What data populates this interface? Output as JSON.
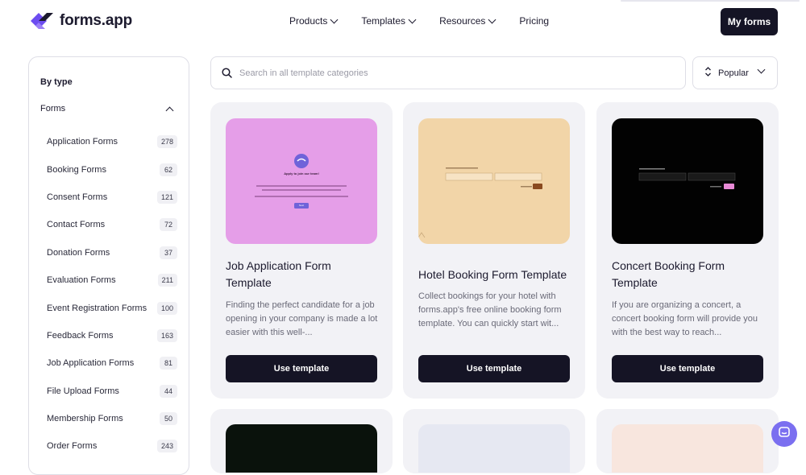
{
  "header": {
    "logo_text": "forms.app",
    "nav": [
      {
        "label": "Products",
        "dropdown": true
      },
      {
        "label": "Templates",
        "dropdown": true
      },
      {
        "label": "Resources",
        "dropdown": true
      },
      {
        "label": "Pricing",
        "dropdown": false
      }
    ],
    "my_forms_label": "My forms"
  },
  "sidebar": {
    "title": "By type",
    "group_label": "Forms",
    "items": [
      {
        "label": "Application Forms",
        "count": "278"
      },
      {
        "label": "Booking Forms",
        "count": "62"
      },
      {
        "label": "Consent Forms",
        "count": "121"
      },
      {
        "label": "Contact Forms",
        "count": "72"
      },
      {
        "label": "Donation Forms",
        "count": "37"
      },
      {
        "label": "Evaluation Forms",
        "count": "211"
      },
      {
        "label": "Event Registration Forms",
        "count": "100"
      },
      {
        "label": "Feedback Forms",
        "count": "163"
      },
      {
        "label": "Job Application Forms",
        "count": "81"
      },
      {
        "label": "File Upload Forms",
        "count": "44"
      },
      {
        "label": "Membership Forms",
        "count": "50"
      },
      {
        "label": "Order Forms",
        "count": "243"
      }
    ]
  },
  "search": {
    "placeholder": "Search in all template categories"
  },
  "sort": {
    "label": "Popular",
    "icon": "sort-arrows-icon"
  },
  "cards": [
    {
      "title": "Job Application Form Template",
      "description": "Finding the perfect candidate for a job opening in your company is made a lot easier with this well-...",
      "button": "Use template",
      "thumb_color": "#e59ee8",
      "thumb_heading": "Apply to join our team!",
      "thumb_button": "Next"
    },
    {
      "title": "Hotel Booking Form Template",
      "description": "Collect bookings for your hotel with forms.app's free online booking form template. You can quickly start wit...",
      "button": "Use template",
      "thumb_color": "#f2d5a8"
    },
    {
      "title": "Concert Booking Form Template",
      "description": "If you are organizing a concert, a concert booking form will provide you with the best way to reach...",
      "button": "Use template",
      "thumb_color": "#020202"
    }
  ],
  "colors": {
    "accent": "#151425",
    "brand": "#6c4cf0",
    "chat": "#7b6ff0"
  }
}
